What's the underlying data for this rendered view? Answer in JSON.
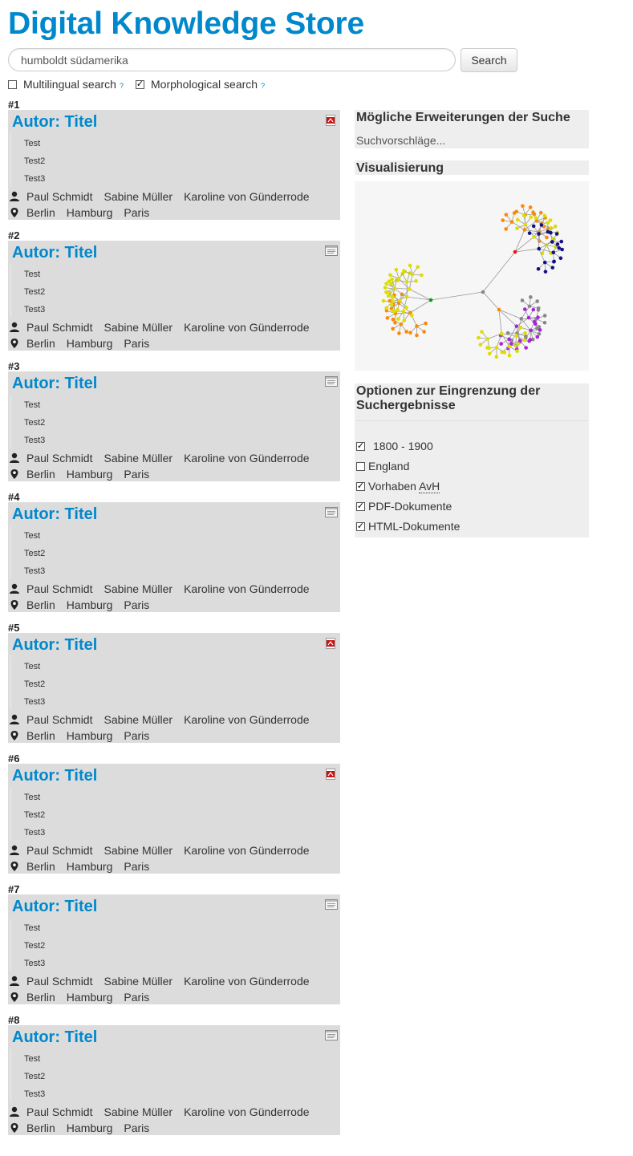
{
  "site": {
    "title": "Digital Knowledge Store"
  },
  "search": {
    "value": "humboldt südamerika",
    "button_label": "Search"
  },
  "options": {
    "multilingual": {
      "label": "Multilingual search",
      "checked": false,
      "info": "?"
    },
    "morphological": {
      "label": "Morphological search",
      "checked": true,
      "info": "?"
    }
  },
  "results": [
    {
      "number": "#1",
      "title": "Autor: Titel",
      "doc_type": "pdf",
      "subitems": [
        "Test",
        "Test2",
        "Test3"
      ],
      "authors": [
        "Paul Schmidt",
        "Sabine Müller",
        "Karoline von Günderrode"
      ],
      "places": [
        "Berlin",
        "Hamburg",
        "Paris"
      ]
    },
    {
      "number": "#2",
      "title": "Autor: Titel",
      "doc_type": "html",
      "subitems": [
        "Test",
        "Test2",
        "Test3"
      ],
      "authors": [
        "Paul Schmidt",
        "Sabine Müller",
        "Karoline von Günderrode"
      ],
      "places": [
        "Berlin",
        "Hamburg",
        "Paris"
      ]
    },
    {
      "number": "#3",
      "title": "Autor: Titel",
      "doc_type": "html",
      "subitems": [
        "Test",
        "Test2",
        "Test3"
      ],
      "authors": [
        "Paul Schmidt",
        "Sabine Müller",
        "Karoline von Günderrode"
      ],
      "places": [
        "Berlin",
        "Hamburg",
        "Paris"
      ]
    },
    {
      "number": "#4",
      "title": "Autor: Titel",
      "doc_type": "html",
      "subitems": [
        "Test",
        "Test2",
        "Test3"
      ],
      "authors": [
        "Paul Schmidt",
        "Sabine Müller",
        "Karoline von Günderrode"
      ],
      "places": [
        "Berlin",
        "Hamburg",
        "Paris"
      ]
    },
    {
      "number": "#5",
      "title": "Autor: Titel",
      "doc_type": "pdf",
      "subitems": [
        "Test",
        "Test2",
        "Test3"
      ],
      "authors": [
        "Paul Schmidt",
        "Sabine Müller",
        "Karoline von Günderrode"
      ],
      "places": [
        "Berlin",
        "Hamburg",
        "Paris"
      ]
    },
    {
      "number": "#6",
      "title": "Autor: Titel",
      "doc_type": "pdf",
      "subitems": [
        "Test",
        "Test2",
        "Test3"
      ],
      "authors": [
        "Paul Schmidt",
        "Sabine Müller",
        "Karoline von Günderrode"
      ],
      "places": [
        "Berlin",
        "Hamburg",
        "Paris"
      ]
    },
    {
      "number": "#7",
      "title": "Autor: Titel",
      "doc_type": "html",
      "subitems": [
        "Test",
        "Test2",
        "Test3"
      ],
      "authors": [
        "Paul Schmidt",
        "Sabine Müller",
        "Karoline von Günderrode"
      ],
      "places": [
        "Berlin",
        "Hamburg",
        "Paris"
      ]
    },
    {
      "number": "#8",
      "title": "Autor: Titel",
      "doc_type": "html",
      "subitems": [
        "Test",
        "Test2",
        "Test3"
      ],
      "authors": [
        "Paul Schmidt",
        "Sabine Müller",
        "Karoline von Günderrode"
      ],
      "places": [
        "Berlin",
        "Hamburg",
        "Paris"
      ]
    }
  ],
  "sidebar": {
    "suggestions": {
      "heading": "Mögliche Erweiterungen der Suche",
      "placeholder": "Suchvorschläge..."
    },
    "visualization": {
      "heading": "Visualisierung"
    },
    "filters": {
      "heading": "Optionen zur Eingrenzung der Suchergebnisse",
      "items": [
        {
          "label": "1800 - 1900",
          "checked": true
        },
        {
          "label": "England",
          "checked": false
        },
        {
          "label_prefix": "Vorhaben ",
          "label_abbr": "AvH",
          "checked": true
        },
        {
          "label": "PDF-Dokumente",
          "checked": true
        },
        {
          "label": "HTML-Dokumente",
          "checked": true
        }
      ]
    }
  },
  "colors": {
    "accent": "#0088cc",
    "result_bg": "#dcdcdc",
    "panel_bg": "#eeeeee"
  },
  "icons": {
    "author": "person-icon",
    "place": "map-marker-icon",
    "pdf": "pdf-file-icon",
    "html": "html-file-icon"
  }
}
